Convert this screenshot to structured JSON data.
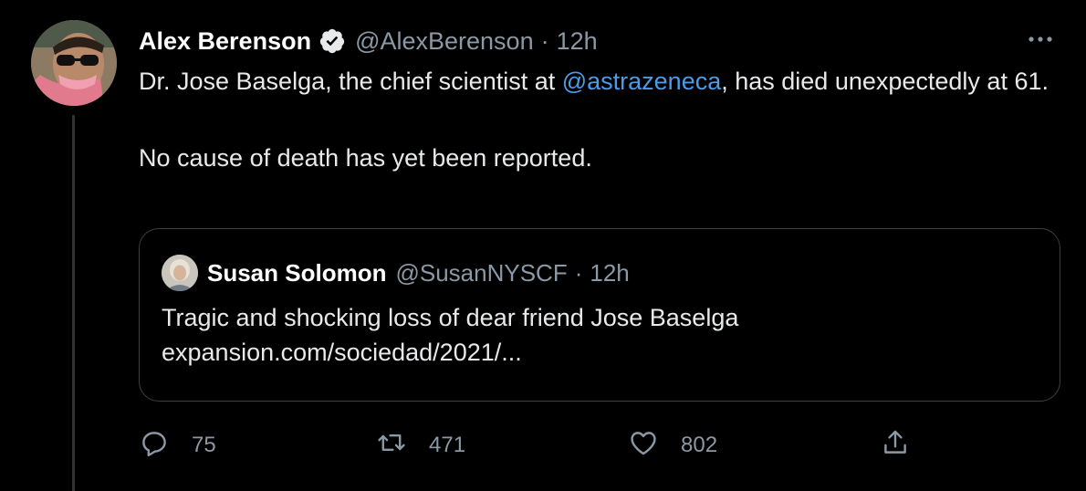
{
  "tweet": {
    "author_name": "Alex Berenson",
    "handle": "@AlexBerenson",
    "separator": "·",
    "time": "12h",
    "text_before_mention": "Dr. Jose Baselga, the chief scientist at ",
    "mention": "@astrazeneca",
    "text_after_mention": ", has died unexpectedly at 61.",
    "text_paragraph_2": "No cause of death has yet been reported."
  },
  "quoted_tweet": {
    "author_name": "Susan Solomon",
    "handle": "@SusanNYSCF",
    "separator": "·",
    "time": "12h",
    "text_line_1": "Tragic and shocking loss of dear friend Jose Baselga",
    "text_line_2": "expansion.com/sociedad/2021/..."
  },
  "actions": {
    "reply_count": "75",
    "retweet_count": "471",
    "like_count": "802"
  },
  "icons": {
    "verified": "verified-badge-icon",
    "more": "more-options-icon",
    "reply": "reply-icon",
    "retweet": "retweet-icon",
    "like": "heart-icon",
    "share": "share-icon"
  },
  "colors": {
    "background": "#000000",
    "text": "#e7e9ea",
    "secondary": "#8b98a5",
    "link": "#4a9be8",
    "border": "#3a3f43"
  }
}
